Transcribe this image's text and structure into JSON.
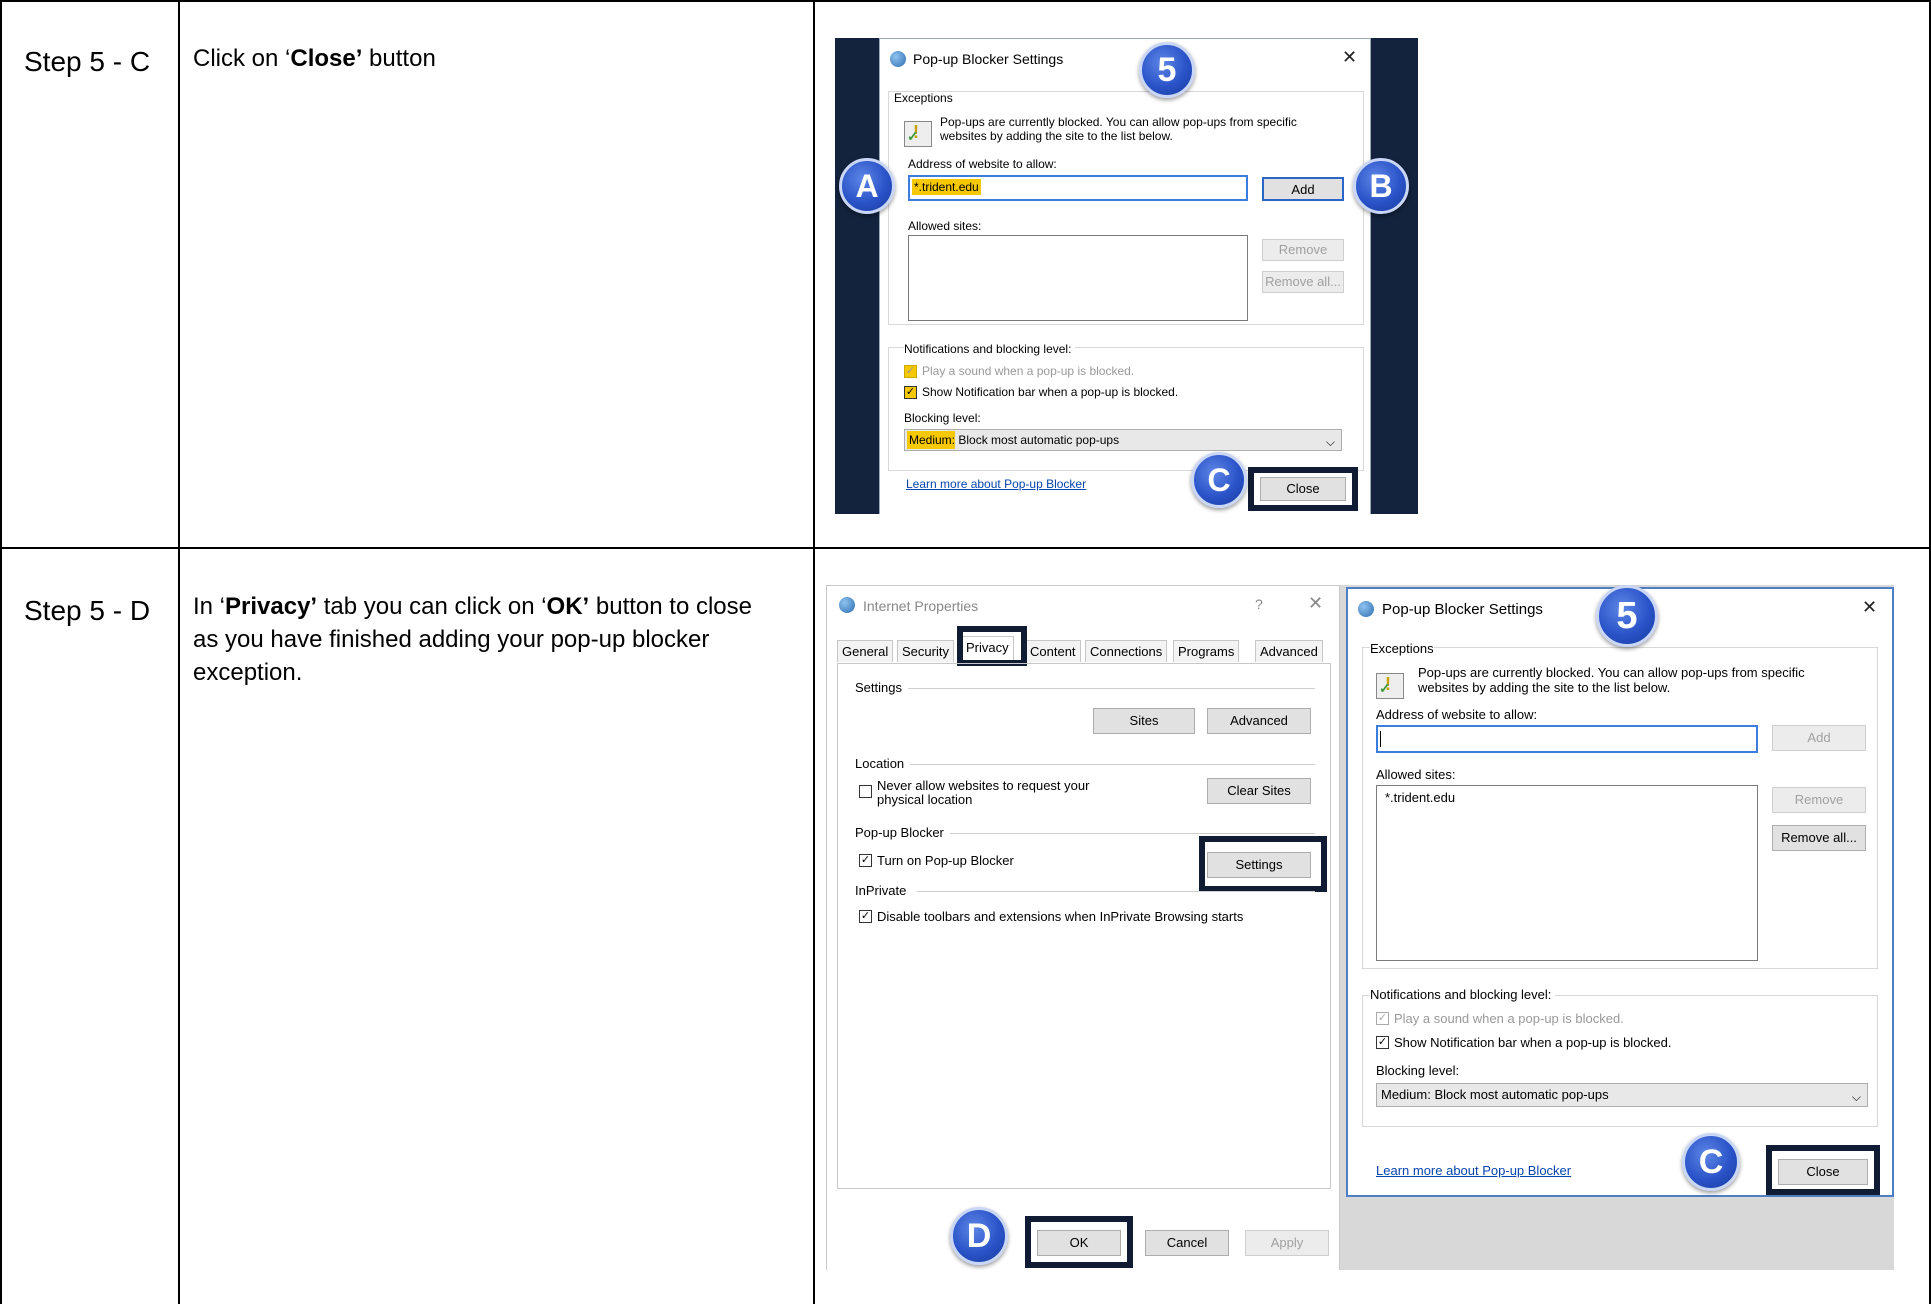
{
  "rows": [
    {
      "step": "Step 5 - C",
      "text_parts": [
        "Click on ‘",
        "Close’",
        " button"
      ]
    },
    {
      "step": "Step 5 - D",
      "text_parts": [
        "In ‘",
        "Privacy’",
        " tab you can click on ‘",
        "OK’",
        " button to close as you have finished adding your pop-up blocker exception."
      ]
    }
  ],
  "shot1": {
    "title": "Pop-up Blocker Settings",
    "exceptions": "Exceptions",
    "info": "Pop-ups are currently blocked.  You can allow pop-ups from specific websites by adding the site to the list below.",
    "address_label": "Address of website to allow:",
    "address_value": "*.trident.edu",
    "add": "Add",
    "allowed_label": "Allowed sites:",
    "remove": "Remove",
    "remove_all": "Remove all...",
    "notif_label": "Notifications and blocking level:",
    "play_sound": "Play a sound when a pop-up is blocked.",
    "show_bar": "Show Notification bar when a pop-up is blocked.",
    "blocking_label": "Blocking level:",
    "blocking_value": "Medium: Block most automatic pop-ups",
    "learn_more": "Learn more about Pop-up Blocker",
    "close": "Close",
    "markers": {
      "five": "5",
      "a": "A",
      "b": "B",
      "c": "C"
    }
  },
  "shot2": {
    "ip_title": "Internet Properties",
    "help": "?",
    "tabs": [
      "General",
      "Security",
      "Privacy",
      "Content",
      "Connections",
      "Programs",
      "Advanced"
    ],
    "settings_label": "Settings",
    "sites": "Sites",
    "advanced": "Advanced",
    "location_label": "Location",
    "never_allow": "Never allow websites to request your physical location",
    "clear_sites": "Clear Sites",
    "popup_label": "Pop-up Blocker",
    "turn_on": "Turn on Pop-up Blocker",
    "settings_btn": "Settings",
    "inprivate_label": "InPrivate",
    "disable_toolbars": "Disable toolbars and extensions when InPrivate Browsing starts",
    "ok": "OK",
    "cancel": "Cancel",
    "apply": "Apply",
    "pb_title": "Pop-up Blocker Settings",
    "exceptions": "Exceptions",
    "info": "Pop-ups are currently blocked.  You can allow pop-ups from specific websites by adding the site to the list below.",
    "address_label": "Address of website to allow:",
    "add": "Add",
    "allowed_label": "Allowed sites:",
    "allowed_site": "*.trident.edu",
    "remove": "Remove",
    "remove_all": "Remove all...",
    "notif_label": "Notifications and blocking level:",
    "play_sound": "Play a sound when a pop-up is blocked.",
    "show_bar": "Show Notification bar when a pop-up is blocked.",
    "blocking_label": "Blocking level:",
    "blocking_value": "Medium: Block most automatic pop-ups",
    "learn_more": "Learn more about Pop-up Blocker",
    "close": "Close",
    "markers": {
      "five": "5",
      "c": "C",
      "d": "D"
    }
  },
  "icons": {
    "globe": "globe-icon",
    "warning": "warning-shield-icon",
    "close": "close-icon",
    "dropdown": "chevron-down-icon"
  },
  "colors": {
    "highlight": "#f5c800",
    "marker": "#2a53c8",
    "callout": "#0f1c33",
    "dark_bg": "#13223d"
  }
}
